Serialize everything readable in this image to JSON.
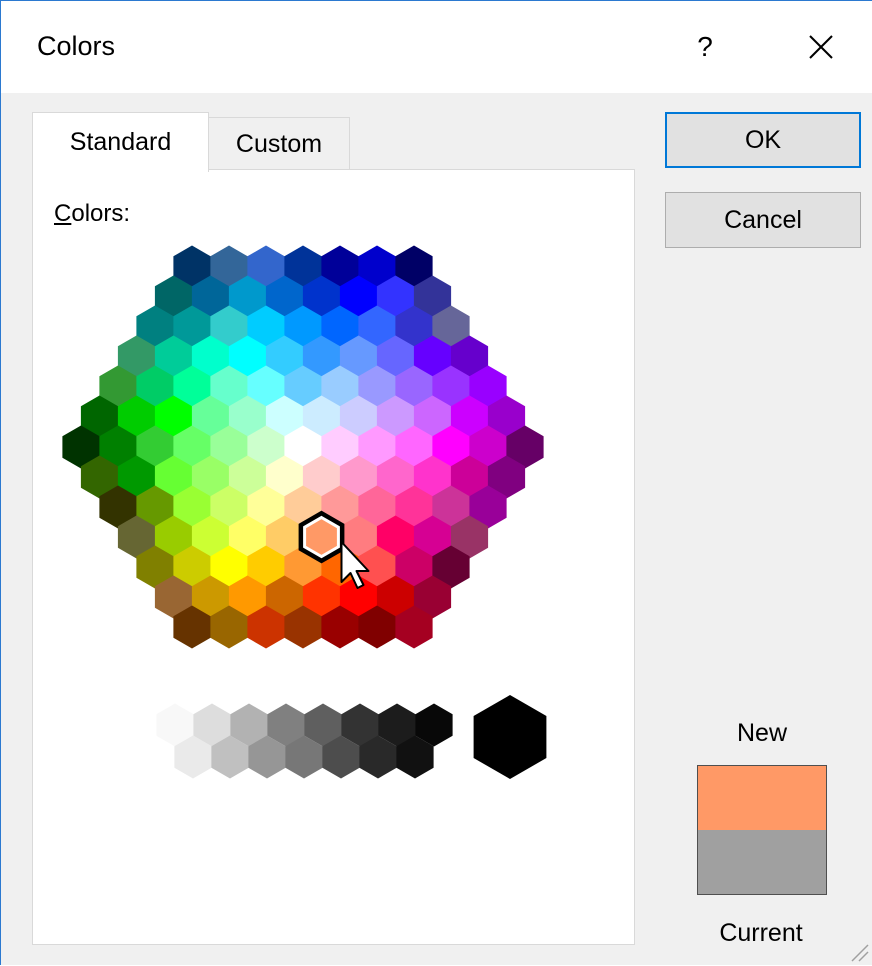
{
  "dialog": {
    "title": "Colors",
    "help_label": "?",
    "close_icon": "close-icon"
  },
  "tabs": [
    {
      "label": "Standard",
      "selected": true
    },
    {
      "label": "Custom",
      "selected": false
    }
  ],
  "colors_label": {
    "underlined": "C",
    "rest": "olors:"
  },
  "buttons": {
    "ok": "OK",
    "cancel": "Cancel"
  },
  "preview": {
    "new_label": "New",
    "current_label": "Current",
    "new_color": "#ff9966",
    "current_color": "#a0a0a0"
  },
  "palette": {
    "rows": [
      [
        "#003366",
        "#336699",
        "#3366cc",
        "#003399",
        "#000099",
        "#0000cc",
        "#000066"
      ],
      [
        "#006666",
        "#006699",
        "#0099cc",
        "#0066cc",
        "#0033cc",
        "#0000ff",
        "#3333ff",
        "#333399"
      ],
      [
        "#008080",
        "#009999",
        "#33cccc",
        "#00ccff",
        "#0099ff",
        "#0066ff",
        "#3366ff",
        "#3333cc",
        "#666699"
      ],
      [
        "#339966",
        "#00cc99",
        "#00ffcc",
        "#00ffff",
        "#33ccff",
        "#3399ff",
        "#6699ff",
        "#6666ff",
        "#6600ff",
        "#6600cc"
      ],
      [
        "#339933",
        "#00cc66",
        "#00ff99",
        "#66ffcc",
        "#66ffff",
        "#66ccff",
        "#99ccff",
        "#9999ff",
        "#9966ff",
        "#9933ff",
        "#9900ff"
      ],
      [
        "#006600",
        "#00cc00",
        "#00ff00",
        "#66ff99",
        "#99ffcc",
        "#ccffff",
        "#ccecff",
        "#ccccff",
        "#cc99ff",
        "#cc66ff",
        "#cc00ff",
        "#9900cc"
      ],
      [
        "#003300",
        "#008000",
        "#33cc33",
        "#66ff66",
        "#99ff99",
        "#ccffcc",
        "#ffffff",
        "#ffccff",
        "#ff99ff",
        "#ff66ff",
        "#ff00ff",
        "#cc00cc",
        "#660066"
      ],
      [
        "#336600",
        "#009900",
        "#66ff33",
        "#99ff66",
        "#ccff99",
        "#ffffcc",
        "#ffcccc",
        "#ff99cc",
        "#ff66cc",
        "#ff33cc",
        "#cc0099",
        "#800080"
      ],
      [
        "#333300",
        "#669900",
        "#99ff33",
        "#ccff66",
        "#ffff99",
        "#ffcc99",
        "#ff9999",
        "#ff6699",
        "#ff3399",
        "#cc3399",
        "#990099"
      ],
      [
        "#666633",
        "#99cc00",
        "#ccff33",
        "#ffff66",
        "#ffcc66",
        "#ff9966",
        "#ff7c80",
        "#ff0066",
        "#d60093",
        "#993366"
      ],
      [
        "#808000",
        "#cccc00",
        "#ffff00",
        "#ffcc00",
        "#ff9933",
        "#ff6600",
        "#ff5050",
        "#cc0066",
        "#660033"
      ],
      [
        "#996633",
        "#cc9900",
        "#ff9900",
        "#cc6600",
        "#ff3300",
        "#ff0000",
        "#cc0000",
        "#990033"
      ],
      [
        "#663300",
        "#996600",
        "#cc3300",
        "#993300",
        "#990000",
        "#800000",
        "#a50021"
      ]
    ],
    "grays": {
      "top": [
        "#f8f8f8",
        "#dddddd",
        "#b2b2b2",
        "#808080",
        "#5f5f5f",
        "#333333",
        "#1c1c1c",
        "#080808"
      ],
      "bottom": [
        "#eaeaea",
        "#c0c0c0",
        "#969696",
        "#777777",
        "#4d4d4d",
        "#292929",
        "#111111"
      ],
      "big": "#000000"
    },
    "selected": {
      "row": 9,
      "col": 5
    }
  }
}
